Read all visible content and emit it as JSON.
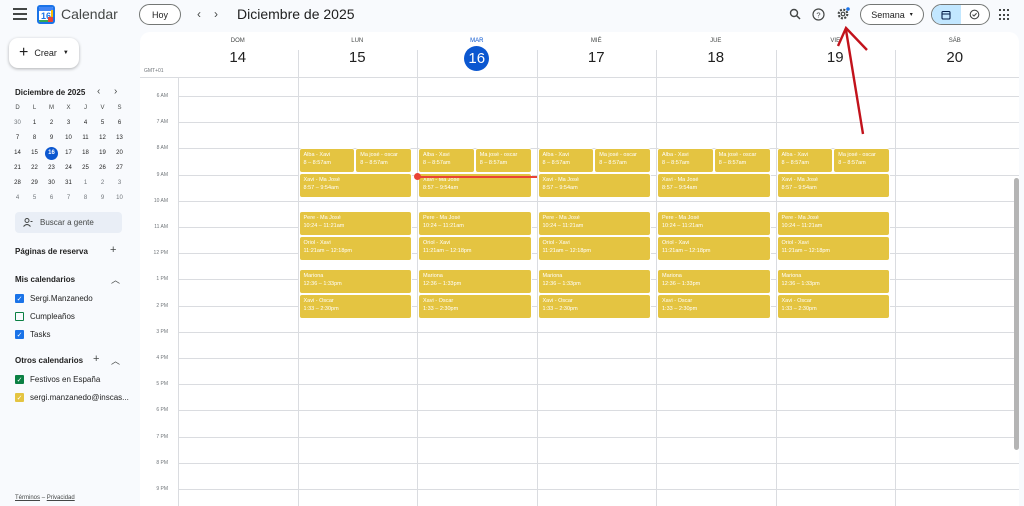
{
  "header": {
    "app_name": "Calendar",
    "logo_day": "16",
    "today_button": "Hoy",
    "prev": "‹",
    "next": "›",
    "title": "Diciembre de 2025",
    "view_label": "Semana",
    "view_caret": "▾"
  },
  "sidebar": {
    "create_label": "Crear",
    "mini_title": "Diciembre de 2025",
    "mini_weekdays": [
      "D",
      "L",
      "M",
      "X",
      "J",
      "V",
      "S"
    ],
    "mini_weeks": [
      [
        "30",
        "1",
        "2",
        "3",
        "4",
        "5",
        "6"
      ],
      [
        "7",
        "8",
        "9",
        "10",
        "11",
        "12",
        "13"
      ],
      [
        "14",
        "15",
        "16",
        "17",
        "18",
        "19",
        "20"
      ],
      [
        "21",
        "22",
        "23",
        "24",
        "25",
        "26",
        "27"
      ],
      [
        "28",
        "29",
        "30",
        "31",
        "1",
        "2",
        "3"
      ],
      [
        "4",
        "5",
        "6",
        "7",
        "8",
        "9",
        "10"
      ]
    ],
    "search_people": "Buscar a gente",
    "booking_pages": "Páginas de reserva",
    "my_calendars": "Mis calendarios",
    "my_cal_items": [
      {
        "name": "Sergi.Manzanedo",
        "color": "#1a73e8",
        "checked": true
      },
      {
        "name": "Cumpleaños",
        "color": "#0b8043",
        "checked": false
      },
      {
        "name": "Tasks",
        "color": "#1a73e8",
        "checked": true
      }
    ],
    "other_calendars": "Otros calendarios",
    "other_cal_items": [
      {
        "name": "Festivos en España",
        "color": "#0b8043",
        "checked": true
      },
      {
        "name": "sergi.manzanedo@inscas...",
        "color": "#e4c441",
        "checked": true
      }
    ],
    "footer_terms": "Términos",
    "footer_sep": "–",
    "footer_privacy": "Privacidad"
  },
  "grid": {
    "timezone": "GMT+01",
    "days": [
      {
        "name": "DOM",
        "num": "14"
      },
      {
        "name": "LUN",
        "num": "15"
      },
      {
        "name": "MAR",
        "num": "16",
        "today": true
      },
      {
        "name": "MIÉ",
        "num": "17"
      },
      {
        "name": "JUE",
        "num": "18"
      },
      {
        "name": "VIE",
        "num": "19"
      },
      {
        "name": "SÁB",
        "num": "20"
      }
    ],
    "hours": [
      "6 AM",
      "7 AM",
      "8 AM",
      "9 AM",
      "10 AM",
      "11 AM",
      "12 PM",
      "1 PM",
      "2 PM",
      "3 PM",
      "4 PM",
      "5 PM",
      "6 PM",
      "7 PM",
      "8 PM",
      "9 PM"
    ],
    "events": [
      {
        "title": "Alba - Xavi",
        "time": "8 – 8:57am",
        "start": 8.0,
        "end": 8.95,
        "half": "left"
      },
      {
        "title": "Ma josé - oscar",
        "time": "8 – 8:57am",
        "start": 8.0,
        "end": 8.95,
        "half": "right"
      },
      {
        "title": "Xavi - Ma José",
        "time": "8:57 – 9:54am",
        "start": 8.95,
        "end": 9.9
      },
      {
        "title": "Pere - Ma José",
        "time": "10:24 – 11:21am",
        "start": 10.4,
        "end": 11.35
      },
      {
        "title": "Oriol - Xavi",
        "time": "11:21am – 12:18pm",
        "start": 11.35,
        "end": 12.3
      },
      {
        "title": "Mariona",
        "time": "12:36 – 1:33pm",
        "start": 12.6,
        "end": 13.55
      },
      {
        "title": "Xavi - Oscar",
        "time": "1:33 – 2:30pm",
        "start": 13.55,
        "end": 14.5
      }
    ],
    "event_days": [
      1,
      2,
      3,
      4,
      5
    ],
    "now_hour": 9.05,
    "event_color": "#e4c441"
  }
}
